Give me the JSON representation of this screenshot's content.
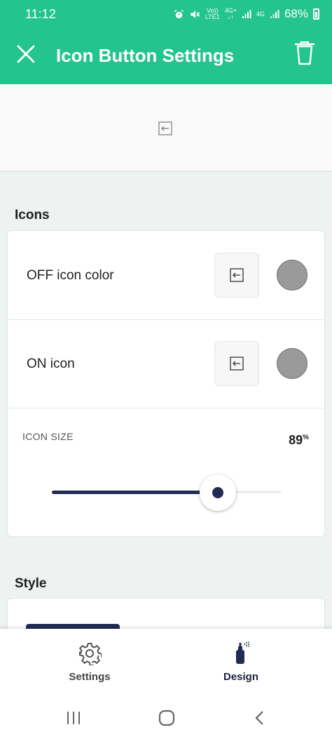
{
  "status_bar": {
    "time": "11:12",
    "network_top": "Vo))",
    "network_bottom": "LTE1",
    "data_top": "4G+",
    "data_bottom": "↓↑",
    "sim2": "4G",
    "battery": "68%"
  },
  "header": {
    "title": "Icon Button Settings",
    "background_color": "#23c48e"
  },
  "icons_section": {
    "heading": "Icons",
    "off_row": {
      "label": "OFF icon color",
      "icon": "arrow-left-box-icon",
      "color": "#9a9a9a"
    },
    "on_row": {
      "label": "ON icon",
      "icon": "arrow-left-box-icon",
      "color": "#9a9a9a"
    },
    "size": {
      "label": "ICON SIZE",
      "value": "89",
      "unit": "%",
      "fraction": 0.89
    }
  },
  "style_section": {
    "heading": "Style"
  },
  "bottom_nav": {
    "items": [
      {
        "label": "Settings",
        "icon": "gear-icon",
        "active": false
      },
      {
        "label": "Design",
        "icon": "spray-can-icon",
        "active": true
      }
    ]
  },
  "system_nav": {
    "buttons": [
      "recents-icon",
      "home-icon",
      "back-icon"
    ]
  },
  "colors": {
    "accent": "#23c48e",
    "slider": "#232b52"
  }
}
